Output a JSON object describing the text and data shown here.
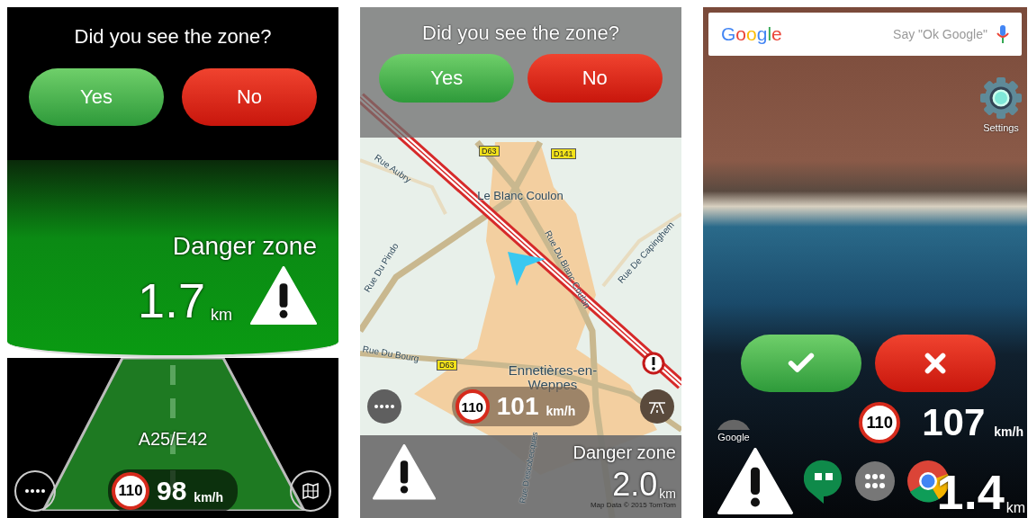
{
  "panels": [
    {
      "kind": "dashboard",
      "question": "Did you see the zone?",
      "buttons": [
        {
          "kind": "yes",
          "label": "Yes"
        },
        {
          "kind": "no",
          "label": "No"
        }
      ],
      "alert": {
        "title": "Danger zone",
        "distance": "1.7",
        "unit": "km"
      },
      "road": "A25/E42",
      "speed_limit": "110",
      "speed": "98",
      "speed_unit": "km/h"
    },
    {
      "kind": "map",
      "question": "Did you see the zone?",
      "buttons": [
        {
          "kind": "yes",
          "label": "Yes"
        },
        {
          "kind": "no",
          "label": "No"
        }
      ],
      "map_labels": [
        "Rue Aubry",
        "Le Blanc Coulon",
        "Rue Du Pindo",
        "Rue Du Blanc Coulon",
        "Rue De Capinghem",
        "Rue Du Bourg",
        "Ennetières-en-Weppes",
        "Rue D'escobecques"
      ],
      "road_shields": [
        "D63",
        "D141",
        "D63"
      ],
      "speed_limit": "110",
      "speed": "101",
      "speed_unit": "km/h",
      "alert": {
        "title": "Danger zone",
        "distance": "2.0",
        "unit": "km"
      },
      "attribution": "Map Data © 2015 TomTom"
    },
    {
      "kind": "home",
      "search": {
        "logo": "Google",
        "placeholder": "Say \"Ok Google\""
      },
      "apps": [
        "Settings",
        "Google"
      ],
      "buttons": [
        {
          "kind": "yes"
        },
        {
          "kind": "no"
        }
      ],
      "speed_limit": "110",
      "speed": "107",
      "speed_unit": "km/h",
      "alert": {
        "distance": "1.4",
        "unit": "km"
      }
    }
  ]
}
